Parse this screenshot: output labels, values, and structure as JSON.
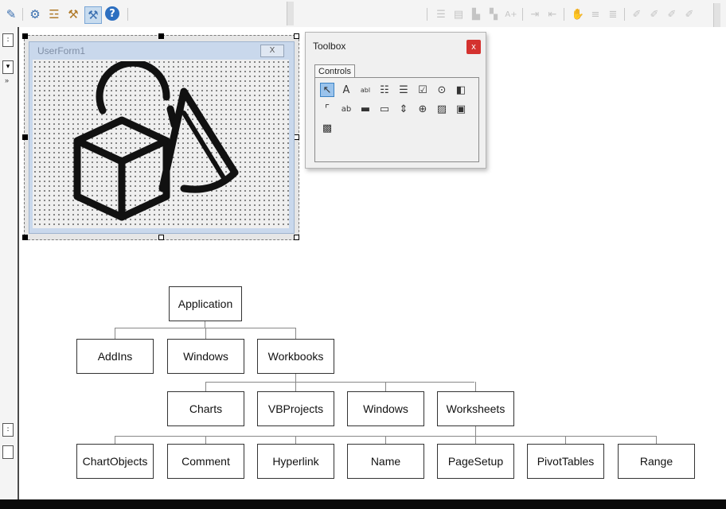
{
  "userform": {
    "title": "UserForm1",
    "close_glyph": "X"
  },
  "toolbox": {
    "title": "Toolbox",
    "close_glyph": "x",
    "tab_label": "Controls",
    "controls": [
      {
        "name": "select-objects-icon",
        "glyph": "↖"
      },
      {
        "name": "label-control-icon",
        "glyph": "A"
      },
      {
        "name": "textbox-control-icon",
        "glyph": "abl"
      },
      {
        "name": "combobox-control-icon",
        "glyph": "☷"
      },
      {
        "name": "listbox-control-icon",
        "glyph": "☰"
      },
      {
        "name": "checkbox-control-icon",
        "glyph": "☑"
      },
      {
        "name": "optionbutton-control-icon",
        "glyph": "⊙"
      },
      {
        "name": "togglebutton-control-icon",
        "glyph": "◧"
      },
      {
        "name": "frame-control-icon",
        "glyph": "⌜"
      },
      {
        "name": "commandbutton-control-icon",
        "glyph": "ab"
      },
      {
        "name": "tabstrip-control-icon",
        "glyph": "▬"
      },
      {
        "name": "multipage-control-icon",
        "glyph": "▭"
      },
      {
        "name": "scrollbar-control-icon",
        "glyph": "⇕"
      },
      {
        "name": "spinbutton-control-icon",
        "glyph": "⊕"
      },
      {
        "name": "image-control-icon",
        "glyph": "▨"
      },
      {
        "name": "refedit-control-icon",
        "glyph": "▣"
      },
      {
        "name": "more-controls-icon",
        "glyph": "▩"
      }
    ]
  },
  "hierarchy": {
    "root": "Application",
    "level1": [
      "AddIns",
      "Windows",
      "Workbooks"
    ],
    "level2": [
      "Charts",
      "VBProjects",
      "Windows",
      "Worksheets"
    ],
    "level3": [
      "ChartObjects",
      "Comment",
      "Hyperlink",
      "Name",
      "PageSetup",
      "PivotTables",
      "Range"
    ]
  },
  "colors": {
    "accent_selected": "#9ac3ec",
    "close_red": "#d4322f",
    "form_border": "#9fb4cf"
  }
}
